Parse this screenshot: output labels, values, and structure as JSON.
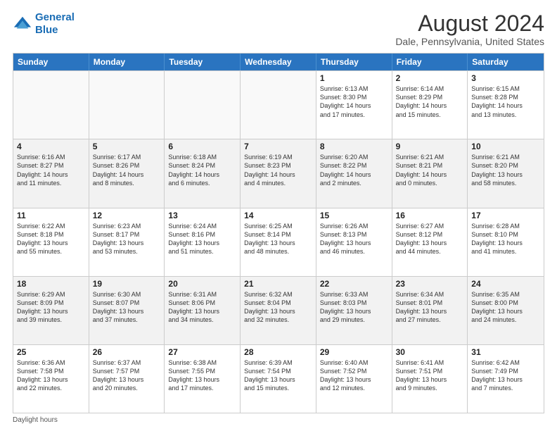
{
  "logo": {
    "line1": "General",
    "line2": "Blue"
  },
  "title": "August 2024",
  "subtitle": "Dale, Pennsylvania, United States",
  "days": [
    "Sunday",
    "Monday",
    "Tuesday",
    "Wednesday",
    "Thursday",
    "Friday",
    "Saturday"
  ],
  "footer": "Daylight hours",
  "rows": [
    [
      {
        "day": "",
        "content": "",
        "empty": true
      },
      {
        "day": "",
        "content": "",
        "empty": true
      },
      {
        "day": "",
        "content": "",
        "empty": true
      },
      {
        "day": "",
        "content": "",
        "empty": true
      },
      {
        "day": "1",
        "content": "Sunrise: 6:13 AM\nSunset: 8:30 PM\nDaylight: 14 hours\nand 17 minutes."
      },
      {
        "day": "2",
        "content": "Sunrise: 6:14 AM\nSunset: 8:29 PM\nDaylight: 14 hours\nand 15 minutes."
      },
      {
        "day": "3",
        "content": "Sunrise: 6:15 AM\nSunset: 8:28 PM\nDaylight: 14 hours\nand 13 minutes."
      }
    ],
    [
      {
        "day": "4",
        "content": "Sunrise: 6:16 AM\nSunset: 8:27 PM\nDaylight: 14 hours\nand 11 minutes."
      },
      {
        "day": "5",
        "content": "Sunrise: 6:17 AM\nSunset: 8:26 PM\nDaylight: 14 hours\nand 8 minutes."
      },
      {
        "day": "6",
        "content": "Sunrise: 6:18 AM\nSunset: 8:24 PM\nDaylight: 14 hours\nand 6 minutes."
      },
      {
        "day": "7",
        "content": "Sunrise: 6:19 AM\nSunset: 8:23 PM\nDaylight: 14 hours\nand 4 minutes."
      },
      {
        "day": "8",
        "content": "Sunrise: 6:20 AM\nSunset: 8:22 PM\nDaylight: 14 hours\nand 2 minutes."
      },
      {
        "day": "9",
        "content": "Sunrise: 6:21 AM\nSunset: 8:21 PM\nDaylight: 14 hours\nand 0 minutes."
      },
      {
        "day": "10",
        "content": "Sunrise: 6:21 AM\nSunset: 8:20 PM\nDaylight: 13 hours\nand 58 minutes."
      }
    ],
    [
      {
        "day": "11",
        "content": "Sunrise: 6:22 AM\nSunset: 8:18 PM\nDaylight: 13 hours\nand 55 minutes."
      },
      {
        "day": "12",
        "content": "Sunrise: 6:23 AM\nSunset: 8:17 PM\nDaylight: 13 hours\nand 53 minutes."
      },
      {
        "day": "13",
        "content": "Sunrise: 6:24 AM\nSunset: 8:16 PM\nDaylight: 13 hours\nand 51 minutes."
      },
      {
        "day": "14",
        "content": "Sunrise: 6:25 AM\nSunset: 8:14 PM\nDaylight: 13 hours\nand 48 minutes."
      },
      {
        "day": "15",
        "content": "Sunrise: 6:26 AM\nSunset: 8:13 PM\nDaylight: 13 hours\nand 46 minutes."
      },
      {
        "day": "16",
        "content": "Sunrise: 6:27 AM\nSunset: 8:12 PM\nDaylight: 13 hours\nand 44 minutes."
      },
      {
        "day": "17",
        "content": "Sunrise: 6:28 AM\nSunset: 8:10 PM\nDaylight: 13 hours\nand 41 minutes."
      }
    ],
    [
      {
        "day": "18",
        "content": "Sunrise: 6:29 AM\nSunset: 8:09 PM\nDaylight: 13 hours\nand 39 minutes."
      },
      {
        "day": "19",
        "content": "Sunrise: 6:30 AM\nSunset: 8:07 PM\nDaylight: 13 hours\nand 37 minutes."
      },
      {
        "day": "20",
        "content": "Sunrise: 6:31 AM\nSunset: 8:06 PM\nDaylight: 13 hours\nand 34 minutes."
      },
      {
        "day": "21",
        "content": "Sunrise: 6:32 AM\nSunset: 8:04 PM\nDaylight: 13 hours\nand 32 minutes."
      },
      {
        "day": "22",
        "content": "Sunrise: 6:33 AM\nSunset: 8:03 PM\nDaylight: 13 hours\nand 29 minutes."
      },
      {
        "day": "23",
        "content": "Sunrise: 6:34 AM\nSunset: 8:01 PM\nDaylight: 13 hours\nand 27 minutes."
      },
      {
        "day": "24",
        "content": "Sunrise: 6:35 AM\nSunset: 8:00 PM\nDaylight: 13 hours\nand 24 minutes."
      }
    ],
    [
      {
        "day": "25",
        "content": "Sunrise: 6:36 AM\nSunset: 7:58 PM\nDaylight: 13 hours\nand 22 minutes."
      },
      {
        "day": "26",
        "content": "Sunrise: 6:37 AM\nSunset: 7:57 PM\nDaylight: 13 hours\nand 20 minutes."
      },
      {
        "day": "27",
        "content": "Sunrise: 6:38 AM\nSunset: 7:55 PM\nDaylight: 13 hours\nand 17 minutes."
      },
      {
        "day": "28",
        "content": "Sunrise: 6:39 AM\nSunset: 7:54 PM\nDaylight: 13 hours\nand 15 minutes."
      },
      {
        "day": "29",
        "content": "Sunrise: 6:40 AM\nSunset: 7:52 PM\nDaylight: 13 hours\nand 12 minutes."
      },
      {
        "day": "30",
        "content": "Sunrise: 6:41 AM\nSunset: 7:51 PM\nDaylight: 13 hours\nand 9 minutes."
      },
      {
        "day": "31",
        "content": "Sunrise: 6:42 AM\nSunset: 7:49 PM\nDaylight: 13 hours\nand 7 minutes."
      }
    ]
  ]
}
